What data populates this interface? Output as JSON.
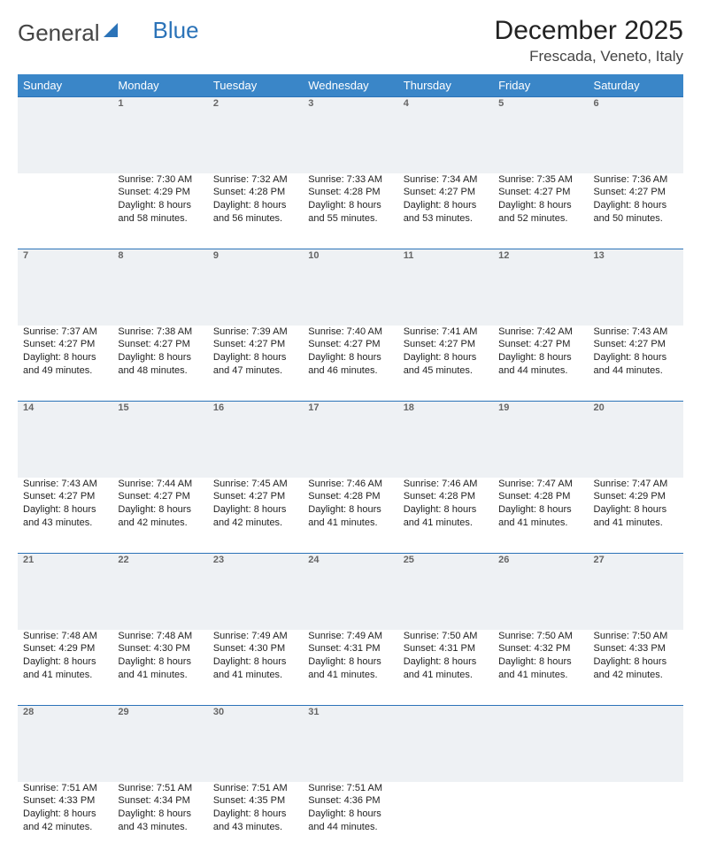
{
  "logo": {
    "part1": "General",
    "part2": "Blue"
  },
  "title": "December 2025",
  "location": "Frescada, Veneto, Italy",
  "weekdays": [
    "Sunday",
    "Monday",
    "Tuesday",
    "Wednesday",
    "Thursday",
    "Friday",
    "Saturday"
  ],
  "weeks": [
    {
      "nums": [
        "",
        "1",
        "2",
        "3",
        "4",
        "5",
        "6"
      ],
      "cells": [
        {
          "sunrise": "",
          "sunset": "",
          "daylight": ""
        },
        {
          "sunrise": "Sunrise: 7:30 AM",
          "sunset": "Sunset: 4:29 PM",
          "daylight": "Daylight: 8 hours and 58 minutes."
        },
        {
          "sunrise": "Sunrise: 7:32 AM",
          "sunset": "Sunset: 4:28 PM",
          "daylight": "Daylight: 8 hours and 56 minutes."
        },
        {
          "sunrise": "Sunrise: 7:33 AM",
          "sunset": "Sunset: 4:28 PM",
          "daylight": "Daylight: 8 hours and 55 minutes."
        },
        {
          "sunrise": "Sunrise: 7:34 AM",
          "sunset": "Sunset: 4:27 PM",
          "daylight": "Daylight: 8 hours and 53 minutes."
        },
        {
          "sunrise": "Sunrise: 7:35 AM",
          "sunset": "Sunset: 4:27 PM",
          "daylight": "Daylight: 8 hours and 52 minutes."
        },
        {
          "sunrise": "Sunrise: 7:36 AM",
          "sunset": "Sunset: 4:27 PM",
          "daylight": "Daylight: 8 hours and 50 minutes."
        }
      ]
    },
    {
      "nums": [
        "7",
        "8",
        "9",
        "10",
        "11",
        "12",
        "13"
      ],
      "cells": [
        {
          "sunrise": "Sunrise: 7:37 AM",
          "sunset": "Sunset: 4:27 PM",
          "daylight": "Daylight: 8 hours and 49 minutes."
        },
        {
          "sunrise": "Sunrise: 7:38 AM",
          "sunset": "Sunset: 4:27 PM",
          "daylight": "Daylight: 8 hours and 48 minutes."
        },
        {
          "sunrise": "Sunrise: 7:39 AM",
          "sunset": "Sunset: 4:27 PM",
          "daylight": "Daylight: 8 hours and 47 minutes."
        },
        {
          "sunrise": "Sunrise: 7:40 AM",
          "sunset": "Sunset: 4:27 PM",
          "daylight": "Daylight: 8 hours and 46 minutes."
        },
        {
          "sunrise": "Sunrise: 7:41 AM",
          "sunset": "Sunset: 4:27 PM",
          "daylight": "Daylight: 8 hours and 45 minutes."
        },
        {
          "sunrise": "Sunrise: 7:42 AM",
          "sunset": "Sunset: 4:27 PM",
          "daylight": "Daylight: 8 hours and 44 minutes."
        },
        {
          "sunrise": "Sunrise: 7:43 AM",
          "sunset": "Sunset: 4:27 PM",
          "daylight": "Daylight: 8 hours and 44 minutes."
        }
      ]
    },
    {
      "nums": [
        "14",
        "15",
        "16",
        "17",
        "18",
        "19",
        "20"
      ],
      "cells": [
        {
          "sunrise": "Sunrise: 7:43 AM",
          "sunset": "Sunset: 4:27 PM",
          "daylight": "Daylight: 8 hours and 43 minutes."
        },
        {
          "sunrise": "Sunrise: 7:44 AM",
          "sunset": "Sunset: 4:27 PM",
          "daylight": "Daylight: 8 hours and 42 minutes."
        },
        {
          "sunrise": "Sunrise: 7:45 AM",
          "sunset": "Sunset: 4:27 PM",
          "daylight": "Daylight: 8 hours and 42 minutes."
        },
        {
          "sunrise": "Sunrise: 7:46 AM",
          "sunset": "Sunset: 4:28 PM",
          "daylight": "Daylight: 8 hours and 41 minutes."
        },
        {
          "sunrise": "Sunrise: 7:46 AM",
          "sunset": "Sunset: 4:28 PM",
          "daylight": "Daylight: 8 hours and 41 minutes."
        },
        {
          "sunrise": "Sunrise: 7:47 AM",
          "sunset": "Sunset: 4:28 PM",
          "daylight": "Daylight: 8 hours and 41 minutes."
        },
        {
          "sunrise": "Sunrise: 7:47 AM",
          "sunset": "Sunset: 4:29 PM",
          "daylight": "Daylight: 8 hours and 41 minutes."
        }
      ]
    },
    {
      "nums": [
        "21",
        "22",
        "23",
        "24",
        "25",
        "26",
        "27"
      ],
      "cells": [
        {
          "sunrise": "Sunrise: 7:48 AM",
          "sunset": "Sunset: 4:29 PM",
          "daylight": "Daylight: 8 hours and 41 minutes."
        },
        {
          "sunrise": "Sunrise: 7:48 AM",
          "sunset": "Sunset: 4:30 PM",
          "daylight": "Daylight: 8 hours and 41 minutes."
        },
        {
          "sunrise": "Sunrise: 7:49 AM",
          "sunset": "Sunset: 4:30 PM",
          "daylight": "Daylight: 8 hours and 41 minutes."
        },
        {
          "sunrise": "Sunrise: 7:49 AM",
          "sunset": "Sunset: 4:31 PM",
          "daylight": "Daylight: 8 hours and 41 minutes."
        },
        {
          "sunrise": "Sunrise: 7:50 AM",
          "sunset": "Sunset: 4:31 PM",
          "daylight": "Daylight: 8 hours and 41 minutes."
        },
        {
          "sunrise": "Sunrise: 7:50 AM",
          "sunset": "Sunset: 4:32 PM",
          "daylight": "Daylight: 8 hours and 41 minutes."
        },
        {
          "sunrise": "Sunrise: 7:50 AM",
          "sunset": "Sunset: 4:33 PM",
          "daylight": "Daylight: 8 hours and 42 minutes."
        }
      ]
    },
    {
      "nums": [
        "28",
        "29",
        "30",
        "31",
        "",
        "",
        ""
      ],
      "cells": [
        {
          "sunrise": "Sunrise: 7:51 AM",
          "sunset": "Sunset: 4:33 PM",
          "daylight": "Daylight: 8 hours and 42 minutes."
        },
        {
          "sunrise": "Sunrise: 7:51 AM",
          "sunset": "Sunset: 4:34 PM",
          "daylight": "Daylight: 8 hours and 43 minutes."
        },
        {
          "sunrise": "Sunrise: 7:51 AM",
          "sunset": "Sunset: 4:35 PM",
          "daylight": "Daylight: 8 hours and 43 minutes."
        },
        {
          "sunrise": "Sunrise: 7:51 AM",
          "sunset": "Sunset: 4:36 PM",
          "daylight": "Daylight: 8 hours and 44 minutes."
        },
        {
          "sunrise": "",
          "sunset": "",
          "daylight": ""
        },
        {
          "sunrise": "",
          "sunset": "",
          "daylight": ""
        },
        {
          "sunrise": "",
          "sunset": "",
          "daylight": ""
        }
      ]
    }
  ]
}
